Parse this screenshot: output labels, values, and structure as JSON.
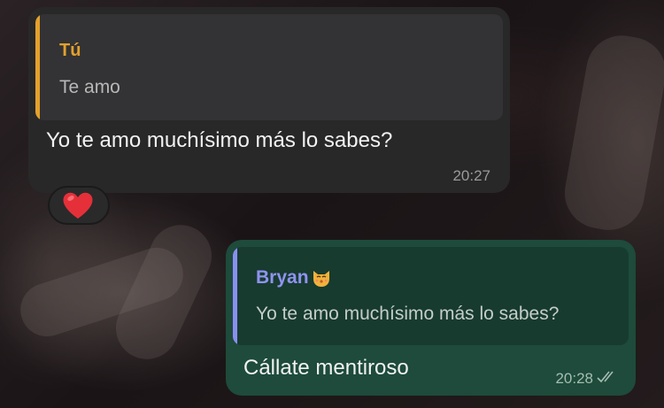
{
  "chat": {
    "incoming": {
      "reply_author": "Tú",
      "reply_text": "Te amo",
      "message": "Yo te amo muchísimo más lo sabes?",
      "time": "20:27",
      "reaction_icon": "red-heart-icon"
    },
    "outgoing": {
      "reply_author": "Bryan",
      "reply_author_emoji": "kissing-cat-icon",
      "reply_text": "Yo te amo muchísimo más lo sabes?",
      "message": "Cállate mentiroso",
      "time": "20:28",
      "status_icon": "double-check-icon"
    }
  },
  "colors": {
    "incoming_bubble": "#282828",
    "outgoing_bubble": "#1e4b3b",
    "reply_bar_incoming": "#e2a12c",
    "reply_bar_outgoing": "#8a8ff0"
  }
}
